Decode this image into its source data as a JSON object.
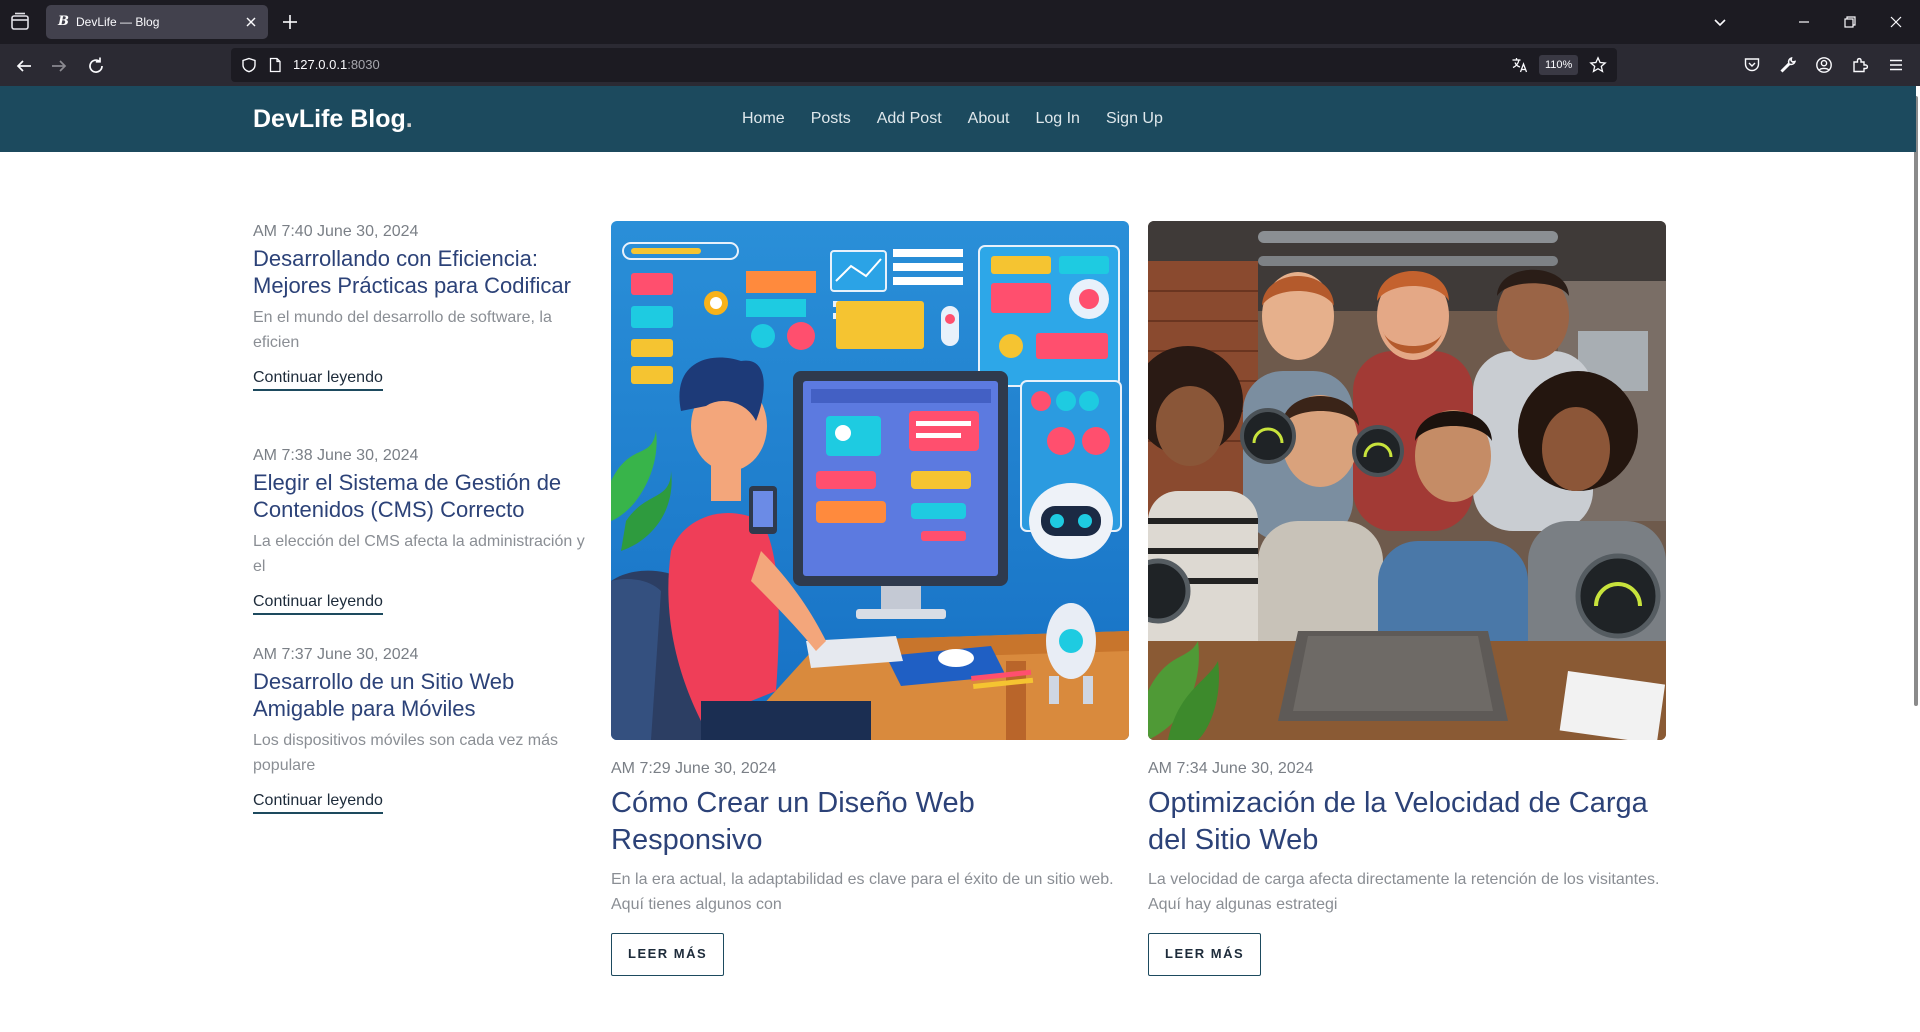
{
  "browser": {
    "tab_title": "DevLife — Blog",
    "favicon_letter": "B",
    "url_host": "127.0.0.1",
    "url_port": ":8030",
    "zoom": "110%"
  },
  "site": {
    "brand": "DevLife Blog",
    "brand_dot": ".",
    "nav": [
      "Home",
      "Posts",
      "Add Post",
      "About",
      "Log In",
      "Sign Up"
    ]
  },
  "side_posts": [
    {
      "date": "AM 7:40 June 30, 2024",
      "title": "Desarrollando con Eficiencia: Mejores Prácticas para Codificar",
      "excerpt": "En el mundo del desarrollo de software, la eficien",
      "link": "Continuar leyendo"
    },
    {
      "date": "AM 7:38 June 30, 2024",
      "title": "Elegir el Sistema de Gestión de Contenidos (CMS) Correcto",
      "excerpt": "La elección del CMS afecta la administración y el",
      "link": "Continuar leyendo"
    },
    {
      "date": "AM 7:37 June 30, 2024",
      "title": "Desarrollo de un Sitio Web Amigable para Móviles",
      "excerpt": "Los dispositivos móviles son cada vez más populare",
      "link": "Continuar leyendo"
    }
  ],
  "cards": [
    {
      "date": "AM 7:29 June 30, 2024",
      "title": "Cómo Crear un Diseño Web Responsivo",
      "excerpt": "En la era actual, la adaptabilidad es clave para el éxito de un sitio web. Aquí tienes algunos con",
      "button": "LEER MÁS"
    },
    {
      "date": "AM 7:34 June 30, 2024",
      "title": "Optimización de la Velocidad de Carga del Sitio Web",
      "excerpt": "La velocidad de carga afecta directamente la retención de los visitantes. Aquí hay algunas estrategi",
      "button": "LEER MÁS"
    }
  ],
  "colors": {
    "header_bg": "#1c4a5e",
    "title_color": "#2c4278",
    "browser_bg": "#1c1b22"
  }
}
